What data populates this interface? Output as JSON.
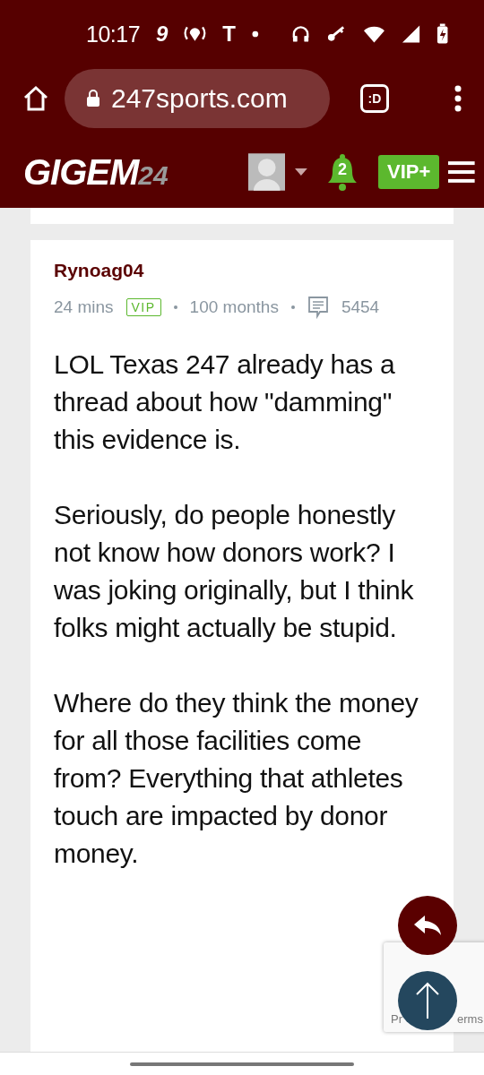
{
  "status_bar": {
    "time": "10:17",
    "app_glyphs": [
      "9",
      "T"
    ]
  },
  "browser": {
    "url": "247sports.com",
    "tab_label": ":D"
  },
  "site_header": {
    "logo_main": "GIGEM",
    "logo_number": "24",
    "notifications": "2",
    "vip_button": "VIP+"
  },
  "post": {
    "author": "Rynoag04",
    "age": "24 mins",
    "badge": "VIP",
    "tenure": "100 months",
    "post_count": "5454",
    "paragraphs": [
      "LOL Texas 247 already has a thread about how \"damming\" this evidence is.",
      "Seriously, do people honestly not know how donors work? I was joking originally, but I think folks might actually be stupid.",
      "Where do they think the money for all those facilities come from? Everything that athletes touch are impacted by donor money."
    ]
  },
  "recaptcha": {
    "left_text": "Pr",
    "right_text": "erms"
  }
}
